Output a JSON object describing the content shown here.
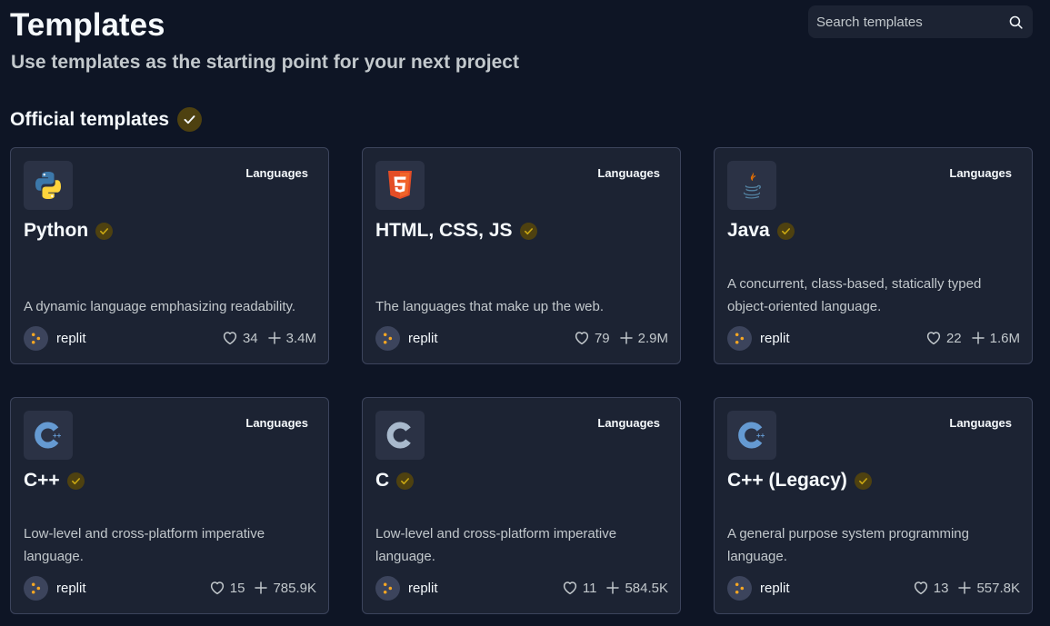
{
  "header": {
    "title": "Templates",
    "subtitle": "Use templates as the starting point for your next project"
  },
  "search": {
    "placeholder": "Search templates",
    "value": "",
    "icon": "search-icon"
  },
  "section": {
    "title": "Official templates",
    "badge_icon": "verified-check-icon"
  },
  "colors": {
    "background": "#0e1525",
    "card": "#1c2333",
    "card_border": "#3c445c",
    "verified_badge": "#4e4110",
    "verified_check": "#c9a713",
    "text_muted": "#c2c8cc"
  },
  "cards": [
    {
      "icon": "python-icon",
      "category": "Languages",
      "title": "Python",
      "description": "A dynamic language emphasizing readability.",
      "author": "replit",
      "likes": "34",
      "forks": "3.4M"
    },
    {
      "icon": "html5-icon",
      "category": "Languages",
      "title": "HTML, CSS, JS",
      "description": "The languages that make up the web.",
      "author": "replit",
      "likes": "79",
      "forks": "2.9M"
    },
    {
      "icon": "java-icon",
      "category": "Languages",
      "title": "Java",
      "description": "A concurrent, class-based, statically typed object-oriented language.",
      "author": "replit",
      "likes": "22",
      "forks": "1.6M"
    },
    {
      "icon": "cpp-icon",
      "category": "Languages",
      "title": "C++",
      "description": "Low-level and cross-platform imperative language.",
      "author": "replit",
      "likes": "15",
      "forks": "785.9K"
    },
    {
      "icon": "c-icon",
      "category": "Languages",
      "title": "C",
      "description": "Low-level and cross-platform imperative language.",
      "author": "replit",
      "likes": "11",
      "forks": "584.5K"
    },
    {
      "icon": "cpp-icon",
      "category": "Languages",
      "title": "C++ (Legacy)",
      "description": "A general purpose system programming language.",
      "author": "replit",
      "likes": "13",
      "forks": "557.8K"
    }
  ]
}
